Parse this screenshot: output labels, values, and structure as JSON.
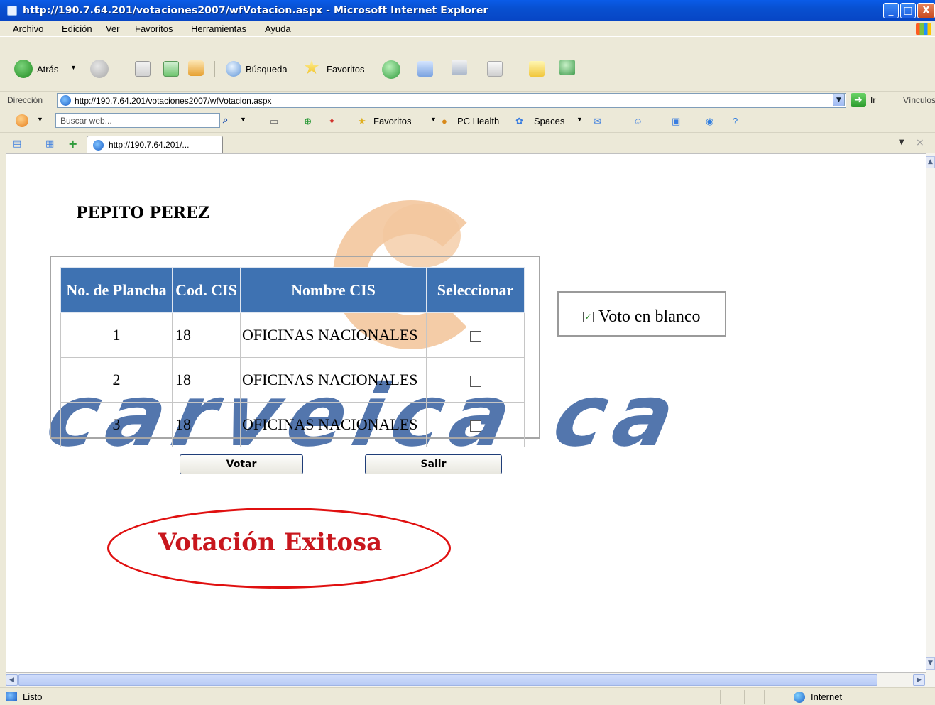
{
  "window": {
    "title": "http://190.7.64.201/votaciones2007/wfVotacion.aspx - Microsoft Internet Explorer",
    "controls": [
      "_",
      "□",
      "X"
    ]
  },
  "menu": [
    "Archivo",
    "Edición",
    "Ver",
    "Favoritos",
    "Herramientas",
    "Ayuda"
  ],
  "toolbar": {
    "back_label": "Atrás",
    "search_label": "Búsqueda",
    "favorites_label": "Favoritos"
  },
  "address": {
    "label": "Dirección",
    "url": "http://190.7.64.201/votaciones2007/wfVotacion.aspx",
    "go_label": "Ir",
    "links_label": "Vínculos"
  },
  "searchbar": {
    "placeholder": "Buscar web...",
    "favorites": "Favoritos",
    "pc_health": "PC Health",
    "spaces": "Spaces"
  },
  "tab": {
    "label": "http://190.7.64.201/..."
  },
  "page": {
    "user_name": "PEPITO PEREZ",
    "watermark": "carveica  ca",
    "table": {
      "headers": [
        "No. de Plancha",
        "Cod. CIS",
        "Nombre CIS",
        "Seleccionar"
      ],
      "rows": [
        {
          "plancha": "1",
          "cod": "18",
          "nombre": "OFICINAS NACIONALES",
          "checked": false
        },
        {
          "plancha": "2",
          "cod": "18",
          "nombre": "OFICINAS NACIONALES",
          "checked": false
        },
        {
          "plancha": "3",
          "cod": "18",
          "nombre": "OFICINAS NACIONALES",
          "checked": false
        }
      ]
    },
    "blank_vote": {
      "label": "Voto en blanco",
      "checked": true
    },
    "buttons": {
      "votar": "Votar",
      "salir": "Salir"
    },
    "result": "Votación Exitosa"
  },
  "status": {
    "text": "Listo",
    "zone": "Internet"
  },
  "colors": {
    "header_bg": "#3e72b2",
    "result_red": "#c8161d",
    "oval": "#e01010",
    "watermark": "#4a6fa9",
    "logo": "#f3c79e"
  }
}
